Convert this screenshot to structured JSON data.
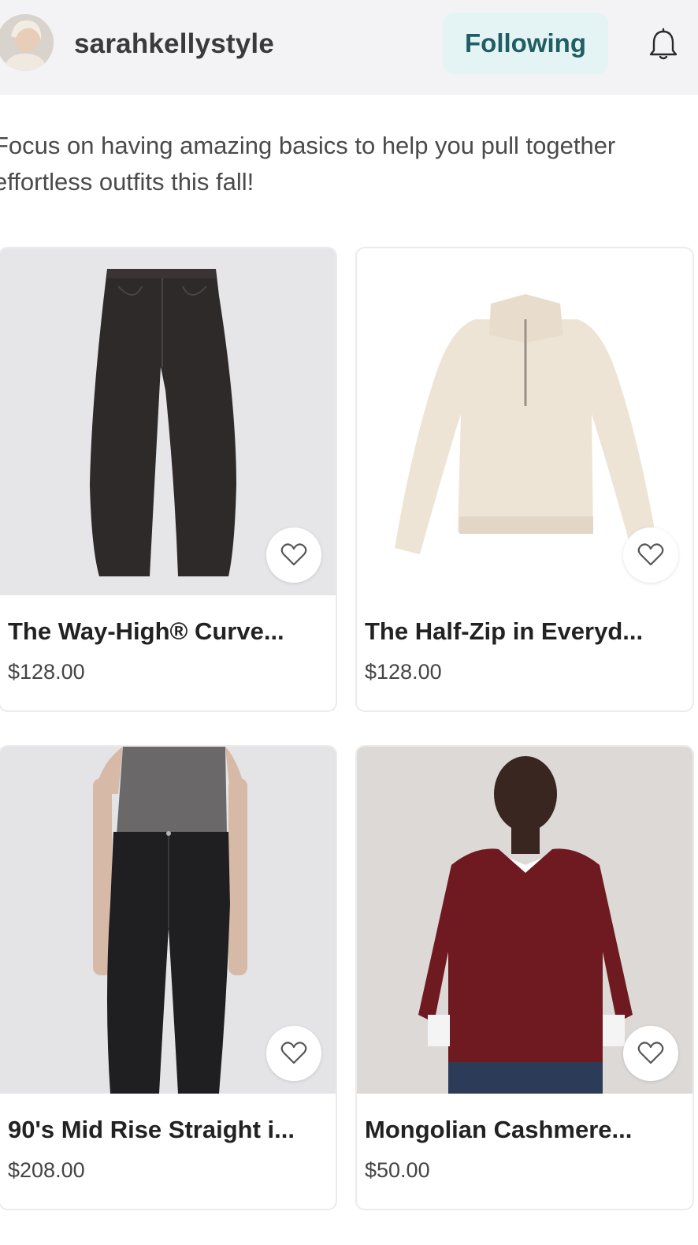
{
  "profile": {
    "username": "sarahkellystyle",
    "follow_label": "Following"
  },
  "caption": "Focus on having amazing basics to help you pull together effortless outfits this fall!",
  "products": [
    {
      "title": "The Way-High® Curve...",
      "price": "$128.00"
    },
    {
      "title": "The Half-Zip in Everyd...",
      "price": "$128.00"
    },
    {
      "title": "90's Mid Rise Straight i...",
      "price": "$208.00"
    },
    {
      "title": "Mongolian Cashmere...",
      "price": "$50.00"
    }
  ],
  "colors": {
    "header_bg": "#f3f3f5",
    "follow_bg": "#e4f4f4",
    "follow_text": "#1f5e63"
  }
}
